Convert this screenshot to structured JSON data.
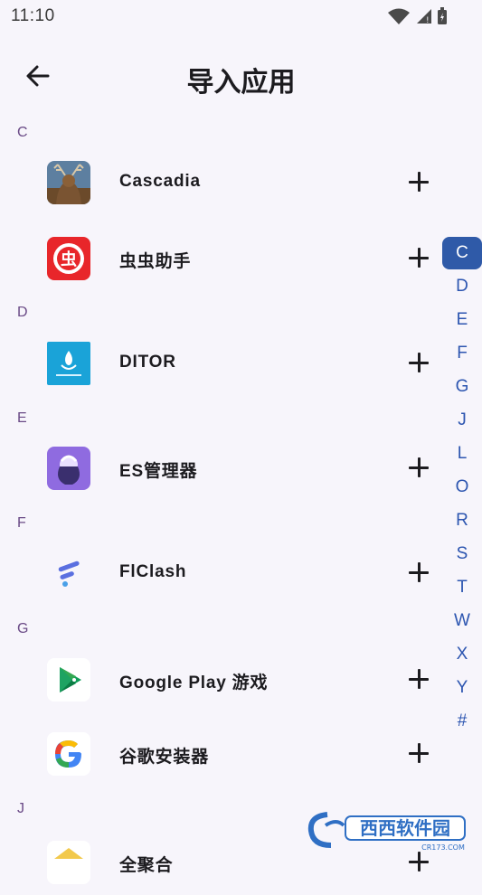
{
  "status": {
    "time": "11:10"
  },
  "header": {
    "title": "导入应用",
    "back_icon": "arrow-left-icon"
  },
  "sections": [
    {
      "letter": "C"
    },
    {
      "letter": "D"
    },
    {
      "letter": "E"
    },
    {
      "letter": "F"
    },
    {
      "letter": "G"
    },
    {
      "letter": "J"
    }
  ],
  "apps": [
    {
      "name": "Cascadia",
      "section": "C"
    },
    {
      "name": "虫虫助手",
      "section": "C"
    },
    {
      "name": "DITOR",
      "section": "D"
    },
    {
      "name": "ES管理器",
      "section": "E"
    },
    {
      "name": "FlClash",
      "section": "F"
    },
    {
      "name": "Google Play 游戏",
      "section": "G"
    },
    {
      "name": "谷歌安装器",
      "section": "G"
    },
    {
      "name": "全聚合",
      "section": "J"
    }
  ],
  "index_bar": {
    "letters": [
      "C",
      "D",
      "E",
      "F",
      "G",
      "J",
      "L",
      "O",
      "R",
      "S",
      "T",
      "W",
      "X",
      "Y",
      "#"
    ],
    "active": "C"
  },
  "watermark": {
    "text": "西西软件园",
    "sub": "CR173.COM"
  },
  "colors": {
    "accent": "#2f5aa8",
    "section_letter": "#6a4a86",
    "background": "#f7f5fb"
  }
}
